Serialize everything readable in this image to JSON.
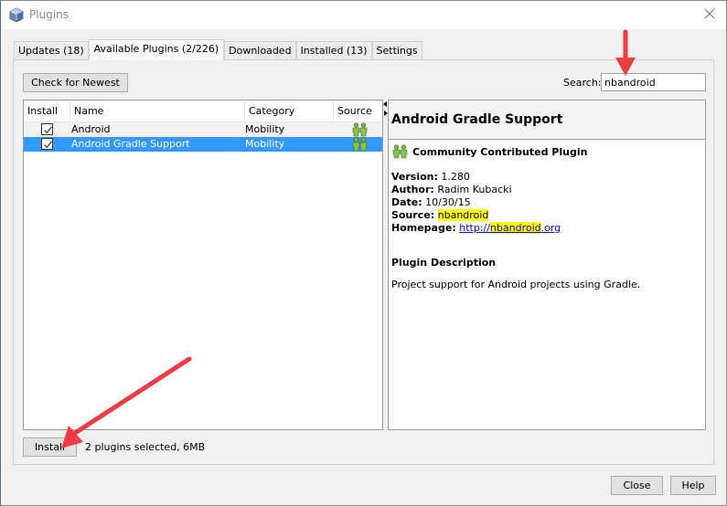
{
  "window": {
    "title": "Plugins",
    "icon": "netbeans-cube-icon"
  },
  "tabs": [
    {
      "label": "Updates (18)",
      "active": false
    },
    {
      "label": "Available Plugins (2/226)",
      "active": true
    },
    {
      "label": "Downloaded",
      "active": false
    },
    {
      "label": "Installed (13)",
      "active": false
    },
    {
      "label": "Settings",
      "active": false
    }
  ],
  "toolbar": {
    "check_newest_label": "Check for Newest",
    "search_label": "Search:",
    "search_value": "nbandroid"
  },
  "table": {
    "columns": [
      "Install",
      "Name",
      "Category",
      "Source"
    ],
    "rows": [
      {
        "install": true,
        "name": "Android",
        "category": "Mobility",
        "source_icon": "community-plugin-icon",
        "selected": false
      },
      {
        "install": true,
        "name": "Android Gradle Support",
        "category": "Mobility",
        "source_icon": "community-plugin-icon",
        "selected": true
      }
    ]
  },
  "detail": {
    "title": "Android Gradle Support",
    "badge": "Community Contributed Plugin",
    "version_label": "Version:",
    "version": "1.280",
    "author_label": "Author:",
    "author": "Radim Kubacki",
    "date_label": "Date:",
    "date": "10/30/15",
    "source_label": "Source:",
    "source": "nbandroid",
    "homepage_label": "Homepage:",
    "homepage_prefix": "http://",
    "homepage_highlight": "nbandroid",
    "homepage_suffix": ".org",
    "description_title": "Plugin Description",
    "description": "Project support for Android projects using Gradle."
  },
  "footer": {
    "install_label": "Install",
    "selection_info": "2 plugins selected, 6MB",
    "close_label": "Close",
    "help_label": "Help"
  },
  "colors": {
    "selection": "#3399ff",
    "highlight": "#ffff00",
    "annotation_arrow": "#ee3b45",
    "link": "#0000ee"
  }
}
